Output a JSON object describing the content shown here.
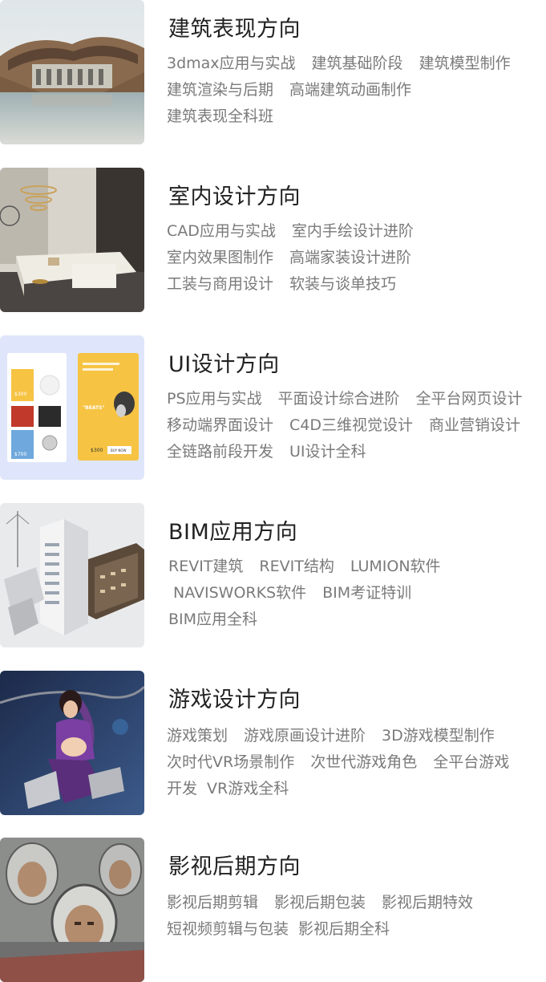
{
  "categories": [
    {
      "title": "建筑表现方向",
      "lines": [
        [
          "3dmax应用与实战",
          "建筑基础阶段",
          "建筑模型制作"
        ],
        [
          "建筑渲染与后期",
          "高端建筑动画制作"
        ],
        [
          "建筑表现全科班"
        ]
      ]
    },
    {
      "title": "室内设计方向",
      "lines": [
        [
          "CAD应用与实战",
          "室内手绘设计进阶"
        ],
        [
          "室内效果图制作",
          "高端家装设计进阶"
        ],
        [
          "工装与商用设计",
          "软装与谈单技巧"
        ]
      ]
    },
    {
      "title": "UI设计方向",
      "lines": [
        [
          "PS应用与实战",
          "平面设计综合进阶",
          "全平台网页设计"
        ],
        [
          "移动端界面设计",
          "C4D三维视觉设计",
          "商业营销设计"
        ],
        [
          "全链路前段开发",
          "UI设计全科"
        ]
      ]
    },
    {
      "title": "BIM应用方向",
      "lines": [
        [
          "REVIT建筑",
          "REVIT结构",
          "LUMION软件"
        ],
        [
          "NAVISWORKS软件",
          "BIM考证特训"
        ],
        [
          "BIM应用全科"
        ]
      ]
    },
    {
      "title": "游戏设计方向",
      "lines": [
        [
          "游戏策划",
          "游戏原画设计进阶",
          "3D游戏模型制作"
        ],
        [
          "次时代VR场景制作",
          "次世代游戏角色",
          "全平台游戏"
        ],
        [
          "开发",
          "VR游戏全科"
        ]
      ]
    },
    {
      "title": "影视后期方向",
      "lines": [
        [
          "影视后期剪辑",
          "影视后期包装",
          "影视后期特效"
        ],
        [
          "短视频剪辑与包装",
          "影视后期全科"
        ]
      ]
    }
  ],
  "ui_mock": {
    "price_1": "$300",
    "price_2": "$700",
    "price_3": "$300",
    "beats": "\"BEATS\"",
    "buy": "BUY NOW"
  },
  "colors": {
    "title": "#222222",
    "tag": "#7a7a7a",
    "ui_bg": "#dfe6fb",
    "ui_yellow": "#f6c343"
  }
}
